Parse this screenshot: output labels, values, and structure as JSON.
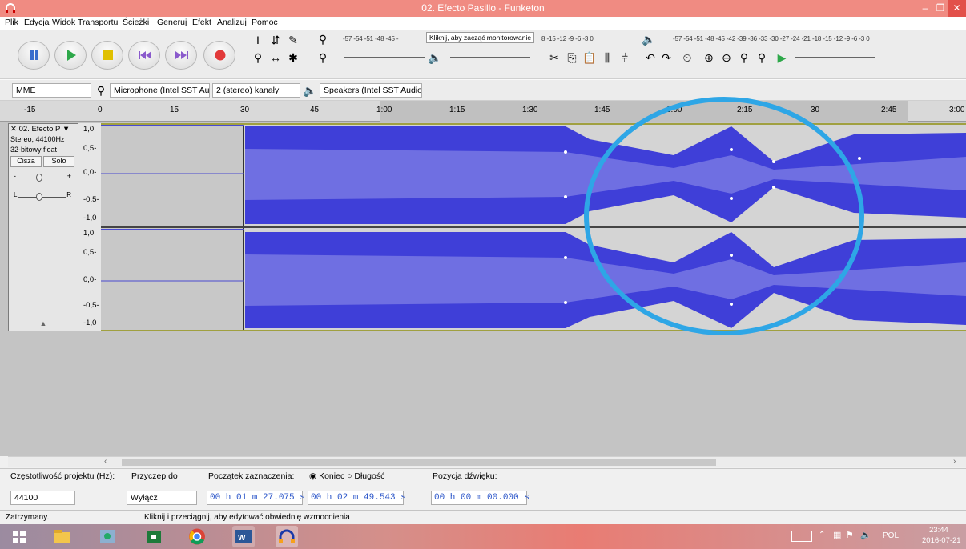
{
  "window": {
    "title": "02. Efecto Pasillo - Funketon",
    "min": "–",
    "max": "❐",
    "close": "✕"
  },
  "menu": [
    "Plik",
    "Edycja",
    "Widok",
    "Transportuj",
    "Ścieżki",
    "Generuj",
    "Efekt",
    "Analizuj",
    "Pomoc"
  ],
  "meters": {
    "record_scale": "-57 -54 -51 -48 -45 -",
    "record_hint": "Kliknij, aby zacząć monitorowanie",
    "record_scale_tail": "8 -15 -12 -9 -6 -3 0",
    "play_scale": "-57 -54 -51 -48 -45 -42 -39 -36 -33 -30 -27 -24 -21 -18 -15 -12 -9 -6 -3 0",
    "lr_record": "L\nR",
    "lr_play": "L\nR"
  },
  "device_toolbar": {
    "host": "MME",
    "mic": "Microphone (Intel SST Aud",
    "channels": "2 (stereo) kanały",
    "speakers": "Speakers (Intel SST Audio D"
  },
  "ruler": {
    "ticks": [
      "-15",
      "0",
      "15",
      "30",
      "45",
      "1:00",
      "1:15",
      "1:30",
      "1:45",
      "2:00",
      "2:15",
      "2:30",
      "2:45",
      "3:00"
    ],
    "hidden_tick": "30"
  },
  "track": {
    "name": "02. Efecto P",
    "rate": "Stereo, 44100Hz",
    "format": "32-bitowy float",
    "mute": "Cisza",
    "solo": "Solo",
    "gain_minus": "-",
    "gain_plus": "+",
    "pan_l": "L",
    "pan_r": "R",
    "collapse": "▲",
    "scale": [
      "1,0",
      "0,5-",
      "0,0-",
      "-0,5-",
      "-1,0"
    ]
  },
  "selection": {
    "rate_label": "Częstotliwość projektu (Hz):",
    "rate_value": "44100",
    "snap_label": "Przyczep do",
    "snap_value": "Wyłącz",
    "start_label": "Początek zaznaczenia:",
    "start_value": "00 h 01 m 27.075 s",
    "end_label": "Koniec",
    "length_label": "Długość",
    "end_value": "00 h 02 m 49.543 s",
    "pos_label": "Pozycja dźwięku:",
    "pos_value": "00 h 00 m 00.000 s"
  },
  "status": {
    "left": "Zatrzymany.",
    "hint": "Kliknij i przeciągnij, aby edytować obwiednię wzmocnienia"
  },
  "tray": {
    "lang": "POL",
    "time": "23:44",
    "date": "2016-07-21"
  },
  "colors": {
    "title": "#f08b82",
    "wave": "#3f3fd8",
    "wave_rms": "#6b6be0",
    "circle": "#2ea6e6"
  }
}
